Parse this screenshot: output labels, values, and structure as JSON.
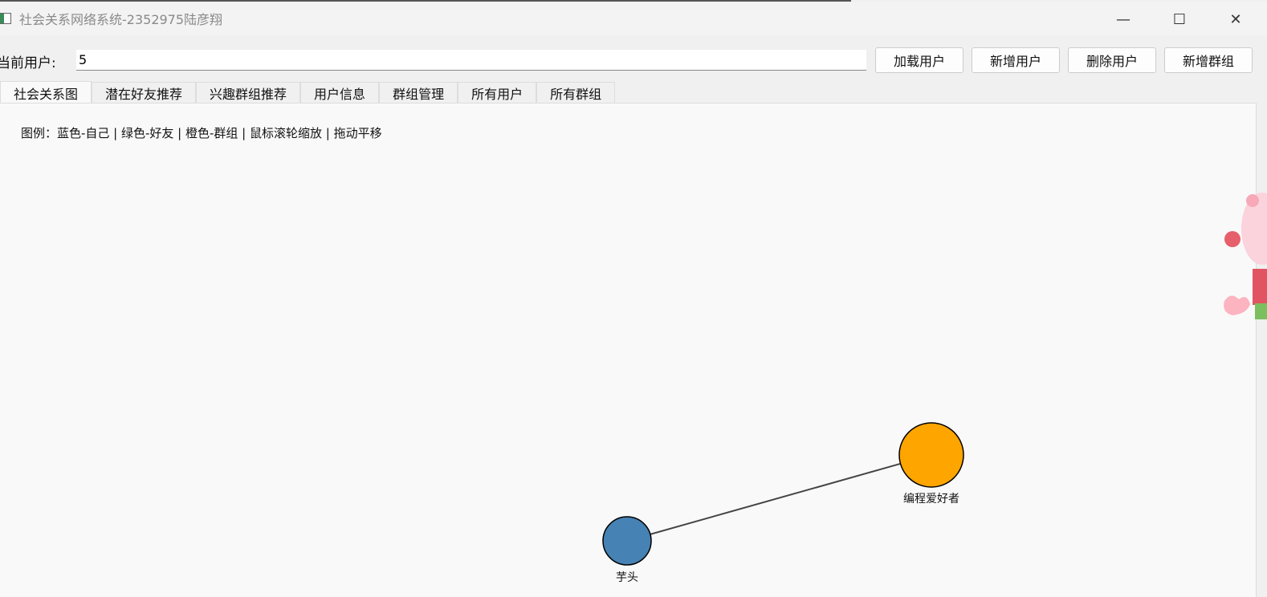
{
  "window": {
    "title": "社会关系网络系统-2352975陆彦翔",
    "minimize": "—",
    "maximize": "☐",
    "close": "✕"
  },
  "toolbar": {
    "current_user_label": "当前用户:",
    "current_user_value": "5",
    "buttons": [
      "加载用户",
      "新增用户",
      "删除用户",
      "新增群组"
    ]
  },
  "tabs": [
    "社会关系图",
    "潜在好友推荐",
    "兴趣群组推荐",
    "用户信息",
    "群组管理",
    "所有用户",
    "所有群组"
  ],
  "graph": {
    "legend": "图例：蓝色-自己 | 绿色-好友 | 橙色-群组 | 鼠标滚轮缩放 | 拖动平移",
    "colors": {
      "self": "#4682b4",
      "group": "#ffa500",
      "edge": "#444444"
    },
    "nodes": [
      {
        "label": "芋头",
        "type": "self"
      },
      {
        "label": "编程爱好者",
        "type": "group"
      }
    ]
  }
}
